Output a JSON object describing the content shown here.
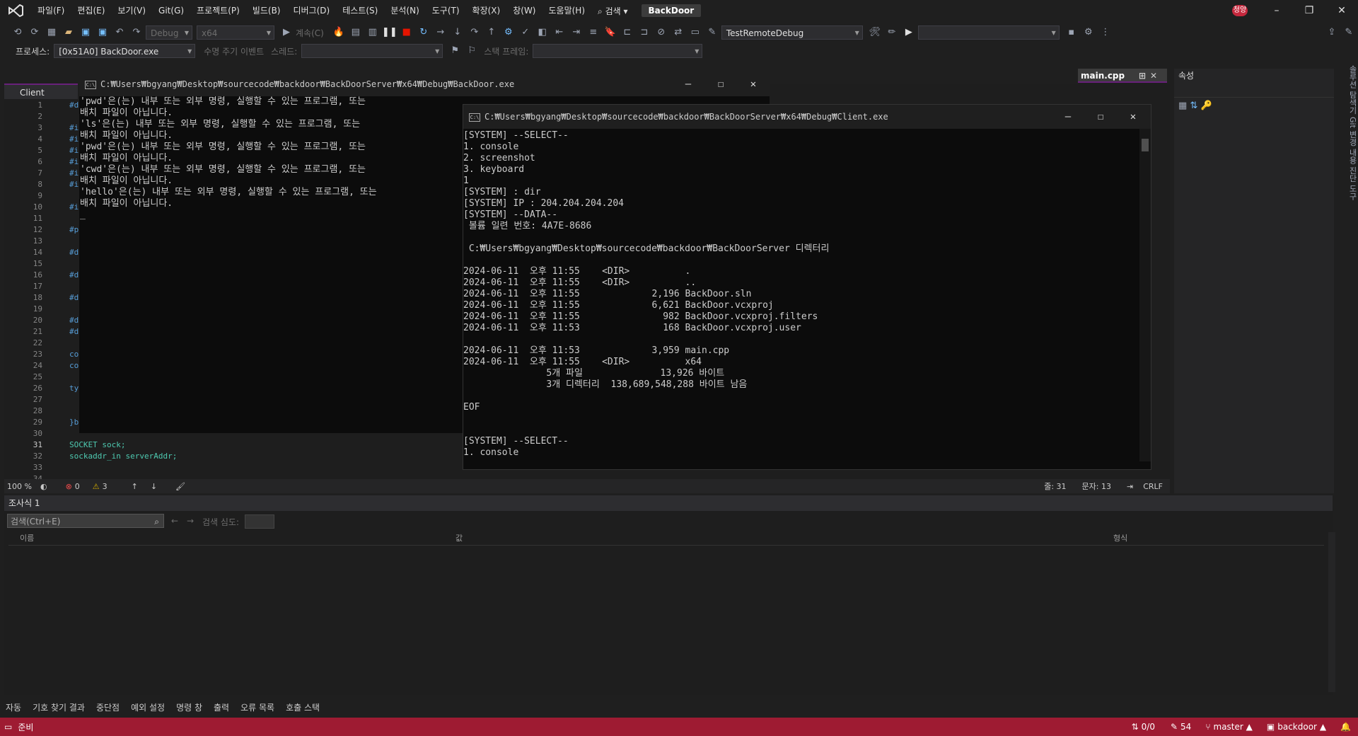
{
  "menu": {
    "items": [
      "파일(F)",
      "편집(E)",
      "보기(V)",
      "Git(G)",
      "프로젝트(P)",
      "빌드(B)",
      "디버그(D)",
      "테스트(S)",
      "분석(N)",
      "도구(T)",
      "확장(X)",
      "창(W)",
      "도움말(H)"
    ],
    "search": "검색",
    "solution": "BackDoor",
    "user_badge": "청양"
  },
  "toolbar": {
    "config": "Debug",
    "platform": "x64",
    "continue": "계속(C)",
    "debug_target": "TestRemoteDebug"
  },
  "debugbar": {
    "process_label": "프로세스:",
    "process_value": "[0x51A0] BackDoor.exe",
    "lifecycle": "수명 주기 이벤트",
    "thread_label": "스레드:",
    "stack_label": "스택 프레임:"
  },
  "editor": {
    "tab_label": "Client",
    "file_tab": "main.cpp",
    "lines": [
      {
        "n": "1",
        "t": "#d"
      },
      {
        "n": "2",
        "t": ""
      },
      {
        "n": "3",
        "t": "#i"
      },
      {
        "n": "4",
        "t": "#i"
      },
      {
        "n": "5",
        "t": "#i"
      },
      {
        "n": "6",
        "t": "#i"
      },
      {
        "n": "7",
        "t": "#i"
      },
      {
        "n": "8",
        "t": "#i"
      },
      {
        "n": "9",
        "t": ""
      },
      {
        "n": "10",
        "t": "#i"
      },
      {
        "n": "11",
        "t": ""
      },
      {
        "n": "12",
        "t": "#p"
      },
      {
        "n": "13",
        "t": ""
      },
      {
        "n": "14",
        "t": "#d"
      },
      {
        "n": "15",
        "t": ""
      },
      {
        "n": "16",
        "t": "#d"
      },
      {
        "n": "17",
        "t": ""
      },
      {
        "n": "18",
        "t": "#d"
      },
      {
        "n": "19",
        "t": ""
      },
      {
        "n": "20",
        "t": "#d"
      },
      {
        "n": "21",
        "t": "#d"
      },
      {
        "n": "22",
        "t": ""
      },
      {
        "n": "23",
        "t": "co"
      },
      {
        "n": "24",
        "t": "co"
      },
      {
        "n": "25",
        "t": ""
      },
      {
        "n": "26",
        "t": "ty"
      },
      {
        "n": "27",
        "t": ""
      },
      {
        "n": "28",
        "t": ""
      },
      {
        "n": "29",
        "t": "}b"
      },
      {
        "n": "30",
        "t": ""
      },
      {
        "n": "31",
        "t": "SOCKET sock;"
      },
      {
        "n": "32",
        "t": "sockaddr_in serverAddr;"
      },
      {
        "n": "33",
        "t": ""
      },
      {
        "n": "34",
        "t": ""
      }
    ],
    "zoom": "100 %",
    "errors": "0",
    "warnings": "3",
    "line_info": "줄: 31",
    "col_info": "문자: 13",
    "eol": "CRLF"
  },
  "properties": {
    "title": "속성"
  },
  "side_strip": "솔루션 탐색기  Git 변경 내용  진단 도구",
  "backdoor_console": {
    "title": "C:₩Users₩bgyang₩Desktop₩sourcecode₩backdoor₩BackDoorServer₩x64₩Debug₩BackDoor.exe",
    "lines": [
      "'pwd'은(는) 내부 또는 외부 명령, 실행할 수 있는 프로그램, 또는",
      "배치 파일이 아닙니다.",
      "'ls'은(는) 내부 또는 외부 명령, 실행할 수 있는 프로그램, 또는",
      "배치 파일이 아닙니다.",
      "'pwd'은(는) 내부 또는 외부 명령, 실행할 수 있는 프로그램, 또는",
      "배치 파일이 아닙니다.",
      "'cwd'은(는) 내부 또는 외부 명령, 실행할 수 있는 프로그램, 또는",
      "배치 파일이 아닙니다.",
      "'hello'은(는) 내부 또는 외부 명령, 실행할 수 있는 프로그램, 또는",
      "배치 파일이 아닙니다.",
      "_"
    ]
  },
  "client_console": {
    "title": "C:₩Users₩bgyang₩Desktop₩sourcecode₩backdoor₩BackDoorServer₩x64₩Debug₩Client.exe",
    "lines": [
      "[SYSTEM] --SELECT--",
      "1. console",
      "2. screenshot",
      "3. keyboard",
      "1",
      "[SYSTEM] : dir",
      "[SYSTEM] IP : 204.204.204.204",
      "[SYSTEM] --DATA--",
      " 볼륨 일련 번호: 4A7E-8686",
      "",
      " C:₩Users₩bgyang₩Desktop₩sourcecode₩backdoor₩BackDoorServer 디렉터리",
      "",
      "2024-06-11  오후 11:55    <DIR>          .",
      "2024-06-11  오후 11:55    <DIR>          ..",
      "2024-06-11  오후 11:55             2,196 BackDoor.sln",
      "2024-06-11  오후 11:55             6,621 BackDoor.vcxproj",
      "2024-06-11  오후 11:55               982 BackDoor.vcxproj.filters",
      "2024-06-11  오후 11:53               168 BackDoor.vcxproj.user",
      "",
      "2024-06-11  오후 11:53             3,959 main.cpp",
      "2024-06-11  오후 11:55    <DIR>          x64",
      "               5개 파일              13,926 바이트",
      "               3개 디렉터리  138,689,548,288 바이트 남음",
      "",
      "EOF",
      "",
      "",
      "[SYSTEM] --SELECT--",
      "1. console"
    ]
  },
  "watch": {
    "title": "조사식 1",
    "search_placeholder": "검색(Ctrl+E)",
    "depth_label": "검색 심도:",
    "col_name": "이름",
    "col_value": "값",
    "col_type": "형식"
  },
  "bottom_tabs": [
    "자동",
    "기호 찾기 결과",
    "중단점",
    "예외 설정",
    "명령 창",
    "출력",
    "오류 목록",
    "호출 스택"
  ],
  "status": {
    "ready": "준비",
    "sync": "0/0",
    "changes": "54",
    "branch": "master",
    "repo": "backdoor"
  },
  "colors": {
    "accent": "#68217a",
    "statusbar": "#9e1b32"
  }
}
